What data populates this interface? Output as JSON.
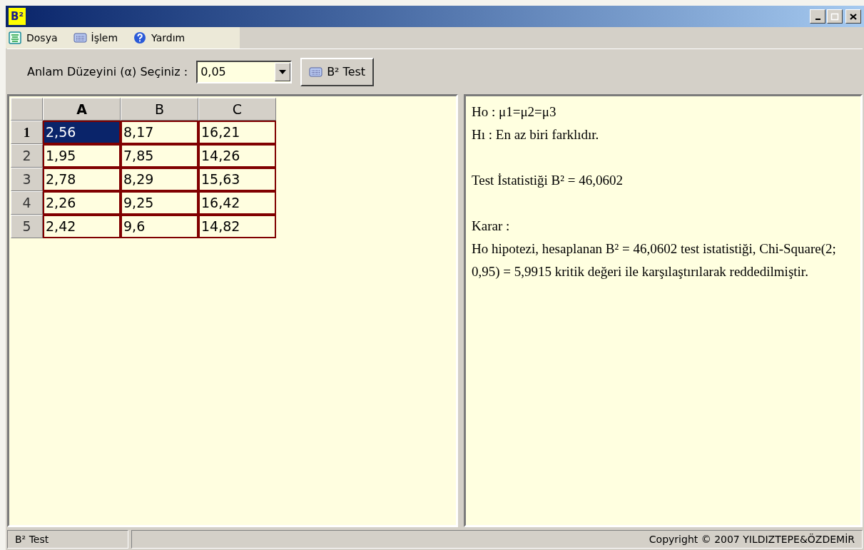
{
  "window": {
    "title_icon": "B²"
  },
  "menu": [
    {
      "label": "Dosya"
    },
    {
      "label": "İşlem"
    },
    {
      "label": "Yardım"
    }
  ],
  "toolbar": {
    "label": "Anlam Düzeyini (α) Seçiniz :",
    "alpha": {
      "value": "0,05"
    },
    "button": "B² Test"
  },
  "table": {
    "columns": [
      {
        "label": "A",
        "selected": true
      },
      {
        "label": "B",
        "selected": false
      },
      {
        "label": "C",
        "selected": false
      }
    ],
    "rows": [
      {
        "label": "1",
        "selected": true,
        "cells": [
          "2,56",
          "8,17",
          "16,21"
        ]
      },
      {
        "label": "2",
        "selected": false,
        "cells": [
          "1,95",
          "7,85",
          "14,26"
        ]
      },
      {
        "label": "3",
        "selected": false,
        "cells": [
          "2,78",
          "8,29",
          "15,63"
        ]
      },
      {
        "label": "4",
        "selected": false,
        "cells": [
          "2,26",
          "9,25",
          "16,42"
        ]
      },
      {
        "label": "5",
        "selected": false,
        "cells": [
          "2,42",
          "9,6",
          "14,82"
        ]
      }
    ]
  },
  "result": {
    "blocks": [
      [
        "Ho : μ1=μ2=μ3",
        "Hı  : En az biri farklıdır."
      ],
      [
        "Test İstatistiği B² = 46,0602"
      ],
      [
        "Karar :",
        "Ho hipotezi, hesaplanan B² = 46,0602 test istatistiği, Chi-Square(2; 0,95) = 5,9915 kritik değeri ile karşılaştırılarak reddedilmiştir."
      ]
    ]
  },
  "status_bar": {
    "left": "B² Test",
    "right": "Copyright © 2007 YILDIZTEPE&ÖZDEMİR"
  }
}
